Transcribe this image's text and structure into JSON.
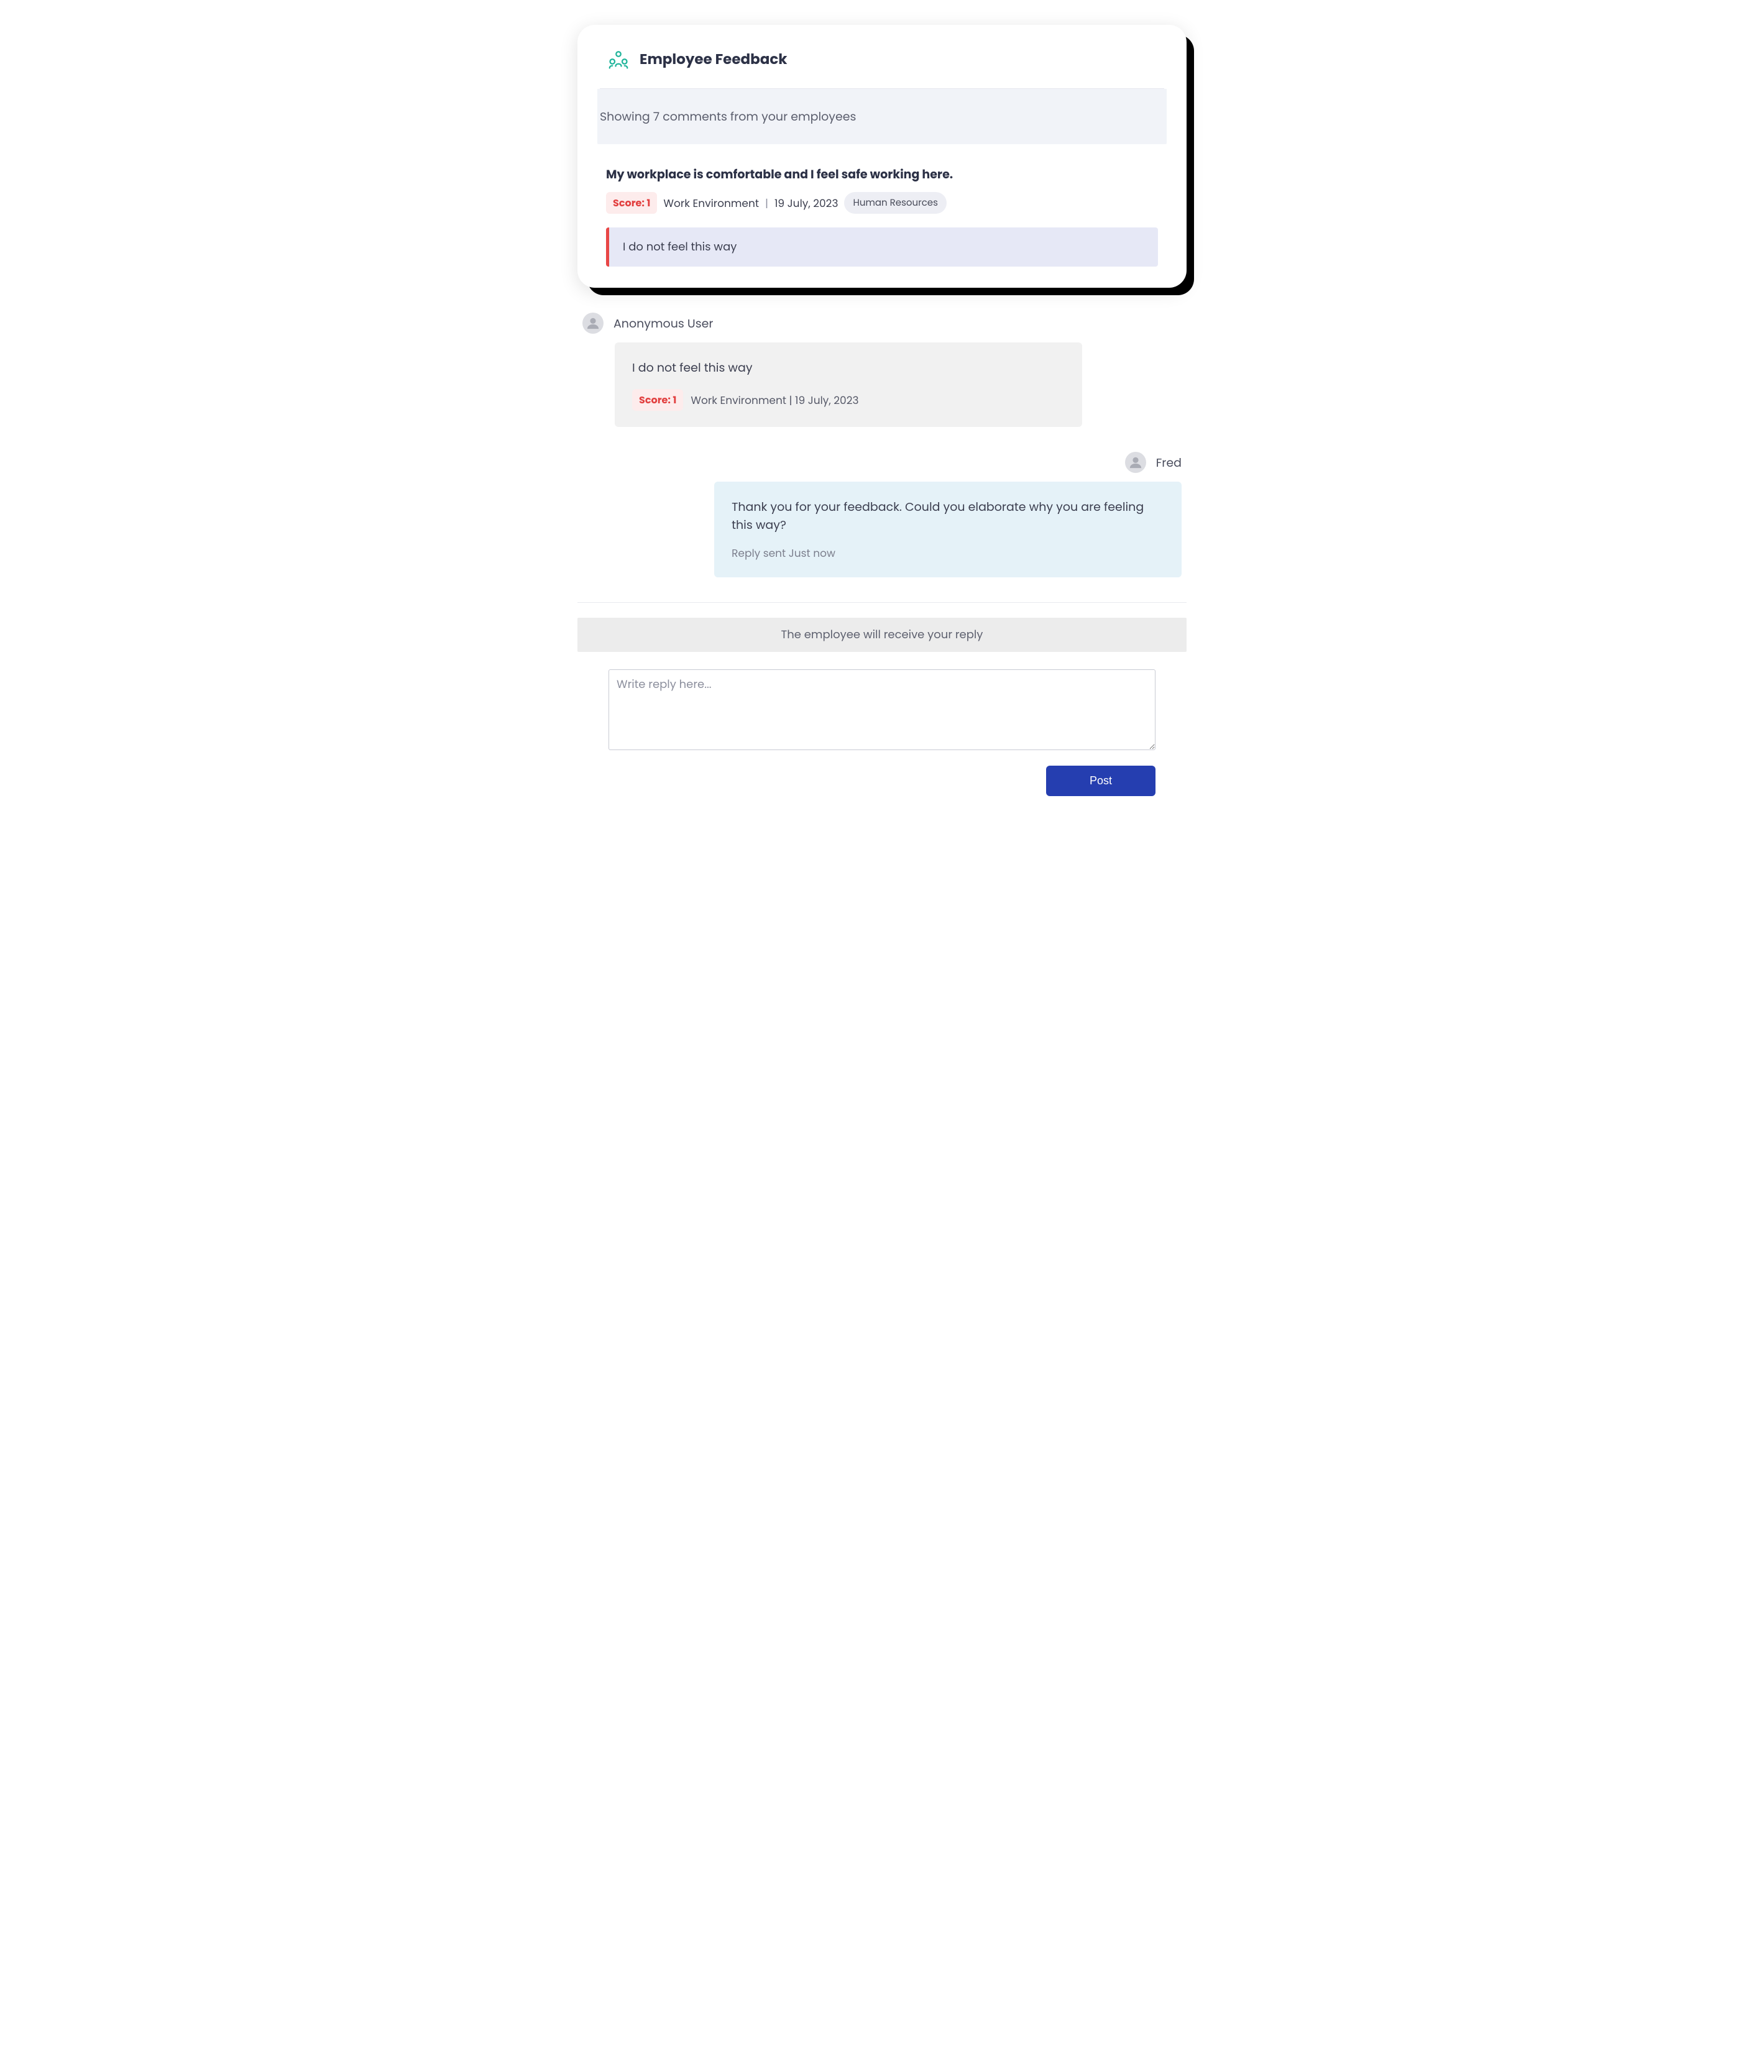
{
  "card": {
    "title": "Employee Feedback",
    "showing": "Showing 7 comments from your employees",
    "item": {
      "title": "My workplace is comfortable and I feel safe working here.",
      "score_label": "Score: 1",
      "category": "Work Environment",
      "date": "19 July, 2023",
      "department": "Human Resources",
      "quote": "I do not feel this way"
    }
  },
  "messages": {
    "anonymous": {
      "author": "Anonymous User",
      "text": "I do not feel this way",
      "score_label": "Score: 1",
      "meta": "Work Environment | 19 July, 2023"
    },
    "reply": {
      "author": "Fred",
      "text": "Thank you for your feedback. Could you elaborate why you are feeling this way?",
      "sent": "Reply sent Just now"
    }
  },
  "compose": {
    "notice": "The employee will receive your reply",
    "placeholder": "Write reply here...",
    "post": "Post"
  },
  "separators": {
    "pipe": "|"
  }
}
